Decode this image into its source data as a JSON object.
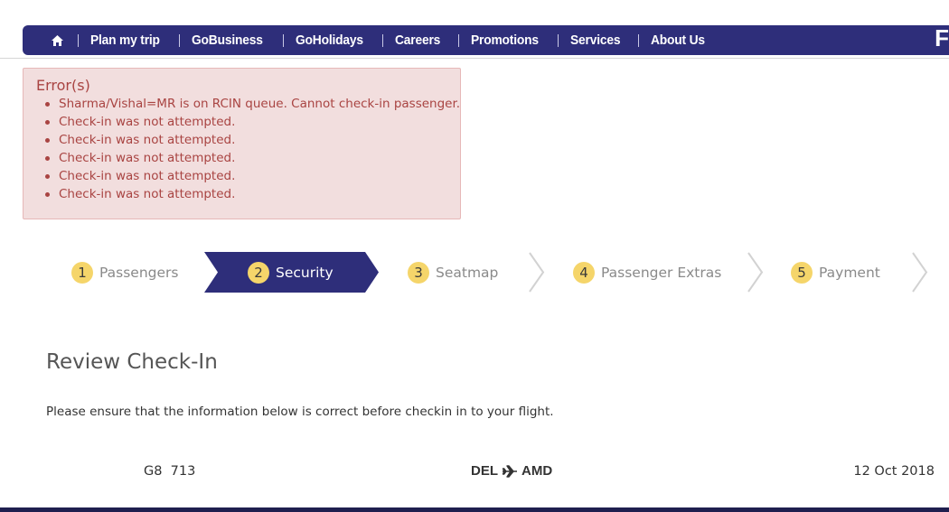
{
  "nav": {
    "home_icon": "home-icon",
    "items": [
      "Plan my trip",
      "GoBusiness",
      "GoHolidays",
      "Careers",
      "Promotions",
      "Services",
      "About Us"
    ],
    "brand_fragment": "F",
    "color": "#2e2e7a"
  },
  "errors": {
    "title": "Error(s)",
    "messages": [
      "Sharma/Vishal=MR is on RCIN queue. Cannot check-in passenger.",
      "Check-in was not attempted.",
      "Check-in was not attempted.",
      "Check-in was not attempted.",
      "Check-in was not attempted.",
      "Check-in was not attempted."
    ],
    "background": "#f2dede",
    "text_color": "#a94442"
  },
  "stepper": {
    "active_index": 1,
    "steps": [
      {
        "num": "1",
        "label": "Passengers"
      },
      {
        "num": "2",
        "label": "Security"
      },
      {
        "num": "3",
        "label": "Seatmap"
      },
      {
        "num": "4",
        "label": "Passenger Extras"
      },
      {
        "num": "5",
        "label": "Payment"
      }
    ],
    "badge_color": "#f5d56a"
  },
  "page": {
    "title": "Review Check-In",
    "description": "Please ensure that the information below is correct before checkin in to your flight."
  },
  "flight": {
    "number": "G8  713",
    "origin": "DEL",
    "destination": "AMD",
    "route_icon": "airplane-icon",
    "date": "12 Oct 2018"
  }
}
